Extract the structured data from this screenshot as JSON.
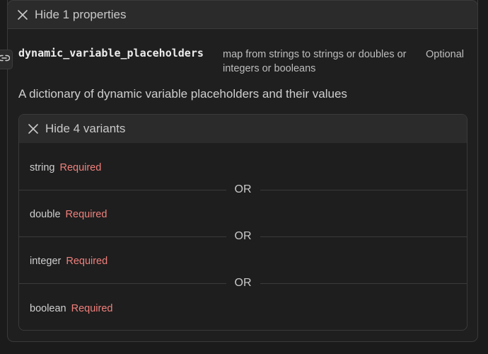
{
  "properties_toggle": {
    "label": "Hide 1 properties",
    "icon": "close-icon"
  },
  "link_badge": {
    "icon": "link-icon"
  },
  "property": {
    "name": "dynamic_variable_placeholders",
    "type": "map from strings to strings or doubles or integers or booleans",
    "optional": "Optional",
    "description": "A dictionary of dynamic variable placeholders and their values"
  },
  "variants_toggle": {
    "label": "Hide 4 variants",
    "icon": "close-icon"
  },
  "variants": [
    {
      "type": "string",
      "required": "Required"
    },
    {
      "type": "double",
      "required": "Required"
    },
    {
      "type": "integer",
      "required": "Required"
    },
    {
      "type": "boolean",
      "required": "Required"
    }
  ],
  "separator": "OR",
  "colors": {
    "background": "#1b1b1b",
    "header": "#2b2b2b",
    "required": "#f0807c",
    "border": "#3a3a3a"
  }
}
